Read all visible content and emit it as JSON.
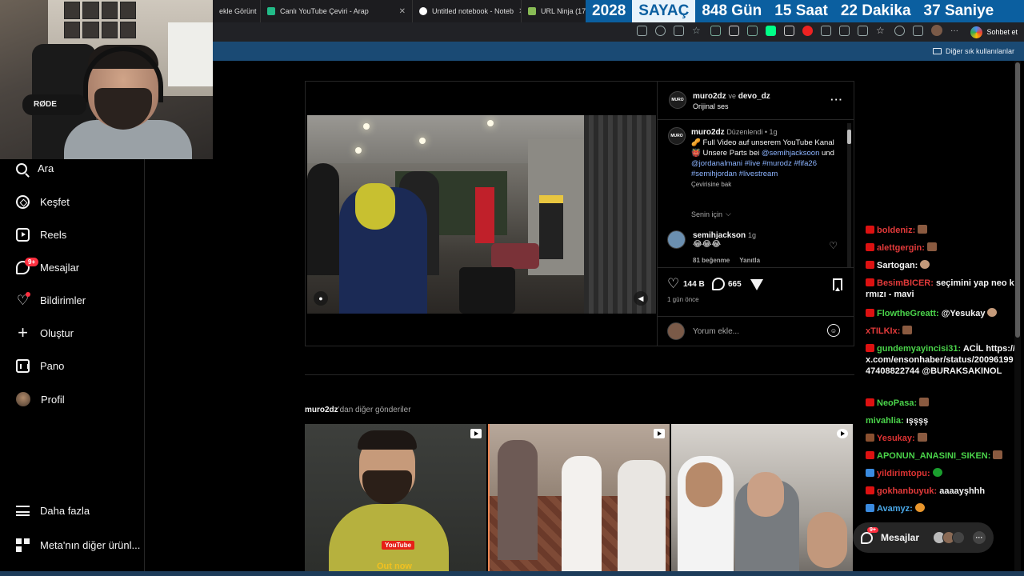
{
  "browser": {
    "tabs": [
      {
        "label": "ekle Görünt",
        "icon_color": "#c33"
      },
      {
        "label": "Canlı YouTube Çeviri - Arap",
        "icon_color": "#2b8"
      },
      {
        "label": "Untitled notebook - Noteb",
        "icon_color": "#fff"
      },
      {
        "label": "URL Ninja (17)",
        "icon_color": "#8b5"
      }
    ],
    "chat_button": "Sohbet et",
    "bookmarks_other": "Diğer sık kullanılanlar"
  },
  "counter": {
    "year": "2028",
    "label": "SAYAÇ",
    "days": "848 Gün",
    "hours": "15 Saat",
    "minutes": "22 Dakika",
    "seconds": "37 Saniye"
  },
  "webcam": {
    "mic_brand": "RØDE"
  },
  "nav": {
    "items": [
      {
        "label": "Ara",
        "icon": "search-icon"
      },
      {
        "label": "Keşfet",
        "icon": "compass-icon"
      },
      {
        "label": "Reels",
        "icon": "reels-icon"
      },
      {
        "label": "Mesajlar",
        "icon": "messenger-icon",
        "badge": "9+"
      },
      {
        "label": "Bildirimler",
        "icon": "heart-icon"
      },
      {
        "label": "Oluştur",
        "icon": "plus-icon"
      },
      {
        "label": "Pano",
        "icon": "dashboard-icon"
      },
      {
        "label": "Profil",
        "icon": "profile-avatar"
      }
    ],
    "more": "Daha fazla",
    "meta": "Meta'nın diğer ürünl..."
  },
  "post": {
    "author": "muro2dz",
    "joiner": "ve",
    "coauthor": "devo_dz",
    "audio": "Orijinal ses",
    "avatar_text": "MURO",
    "caption": {
      "user": "muro2dz",
      "edited": "Düzenlendi",
      "time": "1g",
      "text1": "🥜 Full Video auf unserem YouTube Kanal 👹 Unsere Parts bei",
      "mention1": "@semihjacksoon",
      "and": "und",
      "mention2": "@jordanalmani",
      "tags": "#live #murodz #fifa26 #semihjordan #livestream",
      "translate": "Çevirisine bak"
    },
    "for_you": "Senin için",
    "comment": {
      "user": "semihjackson",
      "time": "1g",
      "text": "😂😂😂",
      "likes": "81 beğenme",
      "reply": "Yanıtla"
    },
    "likes": "144 B",
    "comments": "665",
    "date": "1 gün önce",
    "comment_placeholder": "Yorum ekle..."
  },
  "more_posts": {
    "user": "muro2dz",
    "suffix": "'dan diğer gönderiler",
    "thumb1_youtube": "YouTube",
    "thumb1_outnow": "Out now"
  },
  "chat": [
    {
      "user": "boldeniz:",
      "text": "",
      "color": "#e23a3a",
      "icon": "red",
      "emote": "brown"
    },
    {
      "user": "alettgergin:",
      "text": "",
      "color": "#e23a3a",
      "icon": "red",
      "emote": "brown"
    },
    {
      "user": "Sartogan:",
      "text": "",
      "color": "#f5f5f5",
      "icon": "red",
      "emote": "face"
    },
    {
      "user": "BesimBICER:",
      "text": "seçimini yap neo kırmızı - mavi",
      "color": "#e23a3a",
      "icon": "red",
      "emote": ""
    },
    {
      "user": "FlowtheGreatt:",
      "text": "@Yesukay",
      "color": "#4ad34a",
      "icon": "red",
      "emote": "face"
    },
    {
      "user": "xTILKIx:",
      "text": "",
      "color": "#e23a3a",
      "icon": "",
      "emote": "brown"
    },
    {
      "user": "gundemyayincisi31:",
      "text": "ACİL https://x.com/ensonhaber/status/2009619947408822744 @BURAKSAKINOL",
      "color": "#4ad34a",
      "icon": "red",
      "emote": ""
    },
    {
      "user": "NeoPasa:",
      "text": "",
      "color": "#4ad34a",
      "icon": "red",
      "emote": "brown"
    },
    {
      "user": "mivahlia:",
      "text": "ışşşş",
      "color": "#4ad34a",
      "icon": "",
      "emote": ""
    },
    {
      "user": "Yesukay:",
      "text": "",
      "color": "#d33",
      "icon": "brown",
      "emote": "brown"
    },
    {
      "user": "APONUN_ANASINI_SIKEN:",
      "text": "",
      "color": "#4ad34a",
      "icon": "red",
      "emote": "brown"
    },
    {
      "user": "yildirimtopu:",
      "text": "",
      "color": "#d33",
      "icon": "blue",
      "emote": "green"
    },
    {
      "user": "gokhanbuyuk:",
      "text": "aaaayşhhh",
      "color": "#e23a3a",
      "icon": "red",
      "emote": ""
    },
    {
      "user": "Avamyz:",
      "text": "",
      "color": "#4aa8e8",
      "icon": "blue",
      "emote": "orange"
    }
  ],
  "messages_pill": {
    "label": "Mesajlar",
    "badge": "9+"
  }
}
